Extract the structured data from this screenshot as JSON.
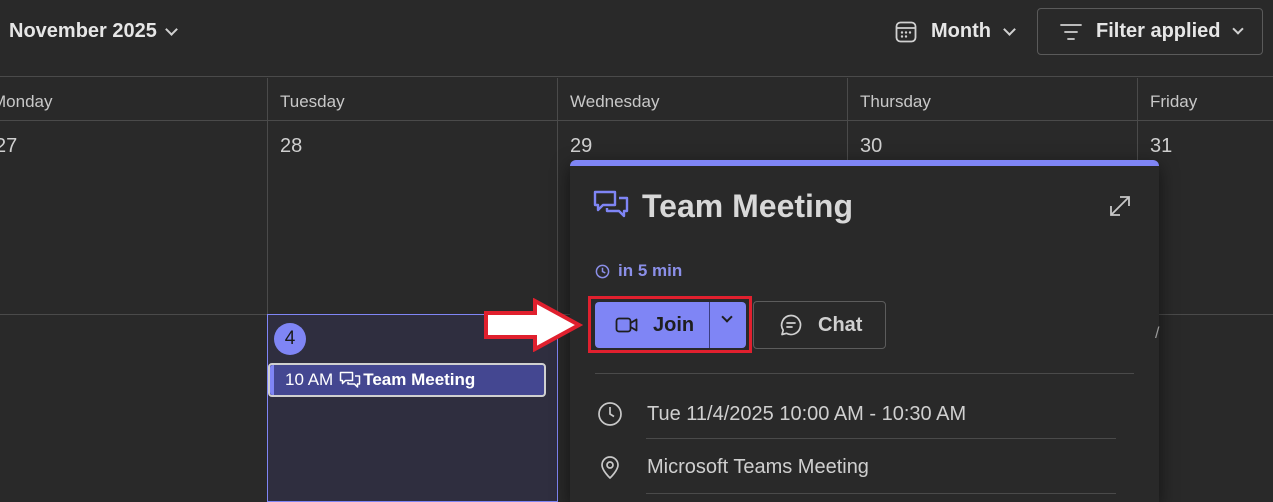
{
  "header": {
    "month_title": "November 2025",
    "view_label": "Month",
    "filter_label": "Filter applied"
  },
  "days": {
    "monday": "Monday",
    "tuesday": "Tuesday",
    "wednesday": "Wednesday",
    "thursday": "Thursday",
    "friday": "Friday"
  },
  "week1_dates": [
    "27",
    "28",
    "29",
    "30",
    "31"
  ],
  "today": {
    "date": "4",
    "event_time": "10 AM",
    "event_title": "Team Meeting"
  },
  "popup": {
    "title": "Team Meeting",
    "status": "in 5 min",
    "join_label": "Join",
    "chat_label": "Chat",
    "datetime": "Tue 11/4/2025 10:00 AM - 10:30 AM",
    "location": "Microsoft Teams Meeting"
  },
  "colors": {
    "accent": "#7f85f5",
    "background": "#292929",
    "today_cell": "#2f2e3f",
    "event_chip": "#444791",
    "highlight": "#e0202e"
  }
}
